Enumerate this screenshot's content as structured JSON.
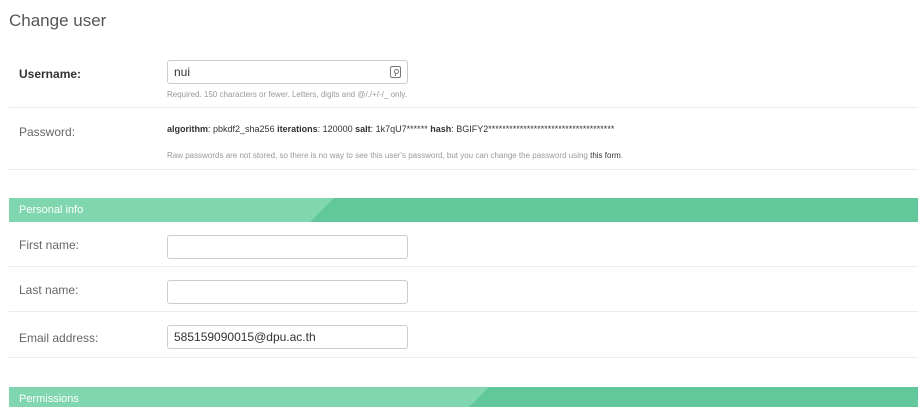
{
  "page": {
    "title": "Change user"
  },
  "username": {
    "label": "Username:",
    "value": "nui",
    "help": "Required. 150 characters or fewer. Letters, digits and @/./+/-/_ only."
  },
  "password": {
    "label": "Password:",
    "algorithm_label": "algorithm",
    "algorithm_value": ": pbkdf2_sha256 ",
    "iterations_label": "iterations",
    "iterations_value": ": 120000 ",
    "salt_label": "salt",
    "salt_value": ": 1k7qU7****** ",
    "hash_label": "hash",
    "hash_value": ": BGIFY2************************************",
    "help_prefix": "Raw passwords are not stored, so there is no way to see this user's password, but you can change the password using ",
    "help_link": "this form",
    "help_suffix": "."
  },
  "personal_info": {
    "title": "Personal info",
    "first_name": {
      "label": "First name:",
      "value": ""
    },
    "last_name": {
      "label": "Last name:",
      "value": ""
    },
    "email": {
      "label": "Email address:",
      "value": "585159090015@dpu.ac.th"
    }
  },
  "permissions": {
    "title": "Permissions"
  },
  "theme": {
    "header_green": "#62c89c",
    "header_light": "#7fd6af"
  },
  "icons": {
    "username_field": "password-manager-key-icon"
  }
}
